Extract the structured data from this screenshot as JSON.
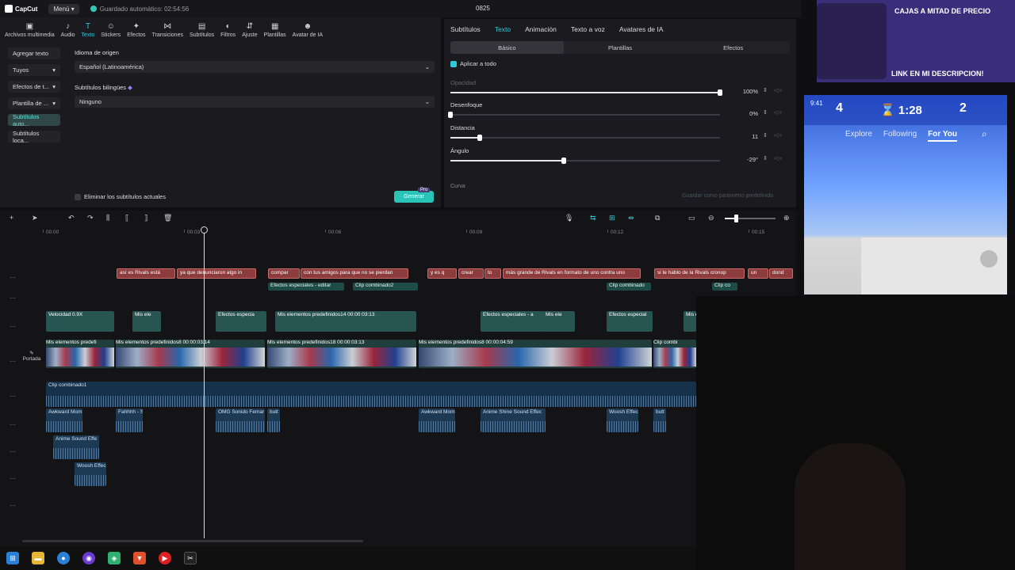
{
  "titlebar": {
    "app_name": "CapCut",
    "menu_label": "Menú",
    "autosave": "Guardado automático: 02:54:56",
    "project_title": "0825"
  },
  "toolbar": {
    "items": [
      {
        "label": "Archivos multimedia",
        "icon": "media-icon"
      },
      {
        "label": "Audio",
        "icon": "audio-icon"
      },
      {
        "label": "Texto",
        "icon": "text-icon",
        "active": true
      },
      {
        "label": "Stickers",
        "icon": "sticker-icon"
      },
      {
        "label": "Efectos",
        "icon": "effects-icon"
      },
      {
        "label": "Transiciones",
        "icon": "transitions-icon"
      },
      {
        "label": "Subtítulos",
        "icon": "subtitles-icon"
      },
      {
        "label": "Filtros",
        "icon": "filters-icon"
      },
      {
        "label": "Ajuste",
        "icon": "adjust-icon"
      },
      {
        "label": "Plantillas",
        "icon": "templates-icon"
      },
      {
        "label": "Avatar de IA",
        "icon": "avatar-icon"
      }
    ]
  },
  "leftnav": {
    "items": [
      {
        "label": "Agregar texto"
      },
      {
        "label": "Tuyos"
      },
      {
        "label": "Efectos de t..."
      },
      {
        "label": "Plantilla de ..."
      },
      {
        "label": "Subtítulos auto..."
      },
      {
        "label": "Subtítulos loca..."
      }
    ]
  },
  "midpanel": {
    "lang_label": "Idioma de origen",
    "lang_value": "Español (Latinoamérica)",
    "bilingual_label": "Subtítulos bilingües",
    "bilingual_value": "Ninguno",
    "remove_label": "Eliminar los subtítulos actuales",
    "generate_label": "Generar",
    "pro_tag": "Pro"
  },
  "rightpanel": {
    "tabs": [
      "Subtítulos",
      "Texto",
      "Animación",
      "Texto a voz",
      "Avatares de IA"
    ],
    "subtabs": [
      "Básico",
      "Plantillas",
      "Efectos"
    ],
    "apply_all": "Aplicar a todo",
    "props": [
      {
        "label": "Opacidad",
        "value": "100%",
        "level": 1.0
      },
      {
        "label": "Desenfoque",
        "value": "0%",
        "level": 0.0
      },
      {
        "label": "Distancia",
        "value": "11",
        "level": 0.11
      },
      {
        "label": "Ángulo",
        "value": "-29°",
        "level": 0.42
      }
    ],
    "curve_label": "Curva",
    "save_default": "Guardar como parámetro predefinido"
  },
  "timeline": {
    "ruler": [
      "00:00",
      "00:03",
      "00:06",
      "00:09",
      "00:12",
      "00:15"
    ],
    "portada": "Portada",
    "captions": [
      "así es Rivals está",
      "ya que denunciaron algo in",
      "compar",
      "con tus amigos para que no se pierdan",
      "y es q",
      "crear",
      "to",
      "más grande de Rivals en formato de uno contra uno",
      "si te hablo de la Rivals cronop",
      "un",
      "dond"
    ],
    "effects": [
      "Efectos especiales - editar",
      "Clip combinado2",
      "Clip combinado",
      "Clip co"
    ],
    "overlays": [
      "Velocidad 0.9X",
      "Mis ele",
      "Efectos especia",
      "Mis elementos predefinidos14  00:00:03:13",
      "Efectos especiales - a",
      "Mis ele",
      "Efectos especial",
      "Mis ele"
    ],
    "main": [
      "Mis elementos predefi",
      "Mis elementos predefinidos8  00:00:03:14",
      "Mis elementos predefinidos18  00:00:03:13",
      "Mis elementos predefinidos8  00:00:04:59",
      "Clip combi"
    ],
    "combined_audio": "Clip combinado1",
    "sfx": [
      "Awkward Mom",
      "Fahhhh - S",
      "OMG Sonido Femar",
      "butt",
      "Awkward Mom",
      "Anime Shine Sound Effec",
      "Woosh Effec",
      "butt",
      "Anime Sound Effe",
      "Woosh Effec"
    ]
  },
  "preview": {
    "hud_left": "4",
    "hud_time": "1:28",
    "hud_right": "2",
    "clock": "9:41",
    "feed_tabs": [
      "Explore",
      "Following",
      "For You"
    ]
  },
  "promo": {
    "line1": "CAJAS A MITAD DE PRECIO",
    "line2": "LINK EN MI DESCRIPCION!"
  },
  "colors": {
    "accent": "#31c9d8",
    "generate": "#2ac3b8",
    "caption_clip": "#8c3c3c",
    "video_clip": "#285452",
    "audio_clip": "#1d3a55"
  }
}
